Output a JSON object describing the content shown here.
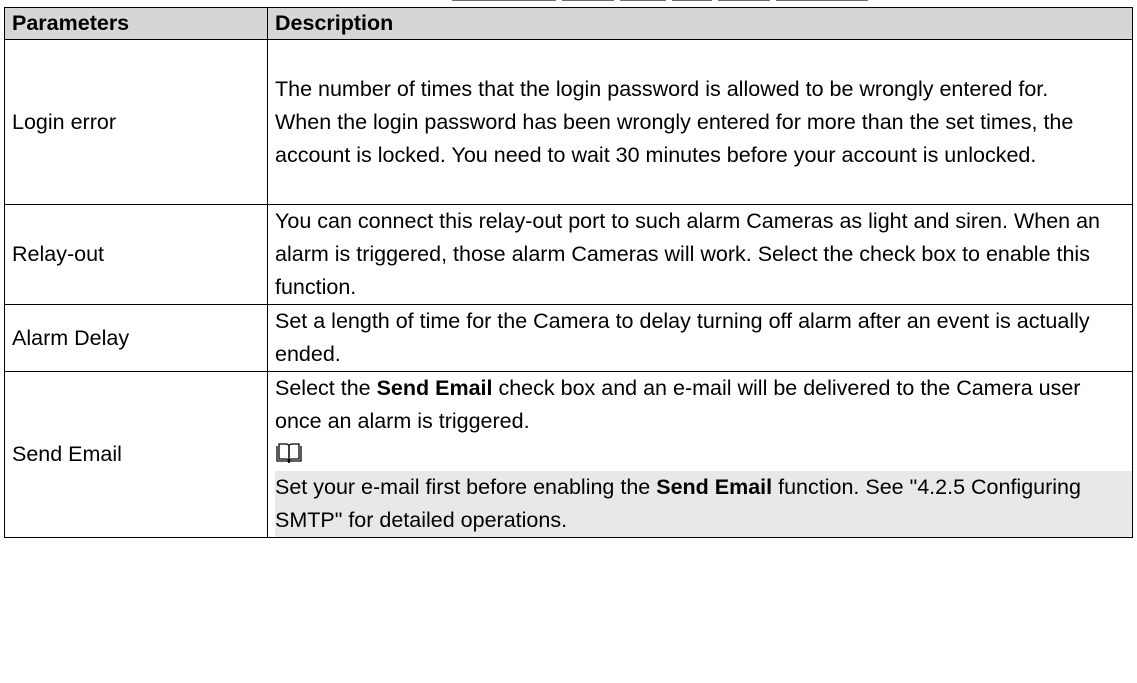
{
  "table": {
    "headers": {
      "parameters": "Parameters",
      "description": "Description"
    },
    "rows": [
      {
        "parameter": "Login error",
        "description": [
          "The number of times that the login password is allowed to be wrongly entered for.",
          "When the login password has been wrongly entered for more than the set times, the account is locked. You need to wait 30 minutes before your account is unlocked."
        ]
      },
      {
        "parameter": "Relay-out",
        "description": [
          "You can connect this relay-out port to such alarm Cameras as light and siren. When an alarm is triggered, those alarm Cameras will work. Select the check box to enable this function."
        ]
      },
      {
        "parameter": "Alarm Delay",
        "description": [
          "Set a length of time for the Camera to delay turning off alarm after an event is actually ended."
        ]
      },
      {
        "parameter": "Send Email",
        "description_intro_before": "Select the ",
        "description_intro_bold": "Send Email",
        "description_intro_after": " check box and an e-mail will be delivered to the Camera user once an alarm is triggered.",
        "note_icon": "note-book-icon",
        "note_before": "Set your e-mail first before enabling the ",
        "note_bold": "Send Email",
        "note_after": " function. See \"4.2.5 Configuring SMTP\" for detailed operations."
      }
    ]
  },
  "colors": {
    "header_background": "#d6d6d6",
    "note_background": "#e8e8e8",
    "border": "#000000"
  }
}
